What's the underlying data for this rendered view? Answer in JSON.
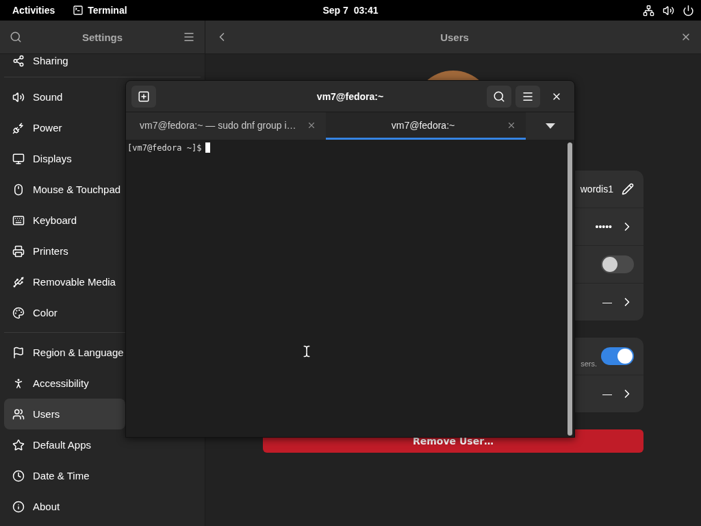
{
  "top_bar": {
    "activities": "Activities",
    "app": "Terminal",
    "date": "Sep 7",
    "time": "03:41"
  },
  "settings": {
    "sidebar_title": "Settings",
    "page_title": "Users",
    "sidebar_groups": [
      [
        {
          "label": "Sharing",
          "selected": false
        }
      ],
      [
        {
          "label": "Sound",
          "selected": false
        },
        {
          "label": "Power",
          "selected": false
        },
        {
          "label": "Displays",
          "selected": false
        },
        {
          "label": "Mouse & Touchpad",
          "selected": false
        },
        {
          "label": "Keyboard",
          "selected": false
        },
        {
          "label": "Printers",
          "selected": false
        },
        {
          "label": "Removable Media",
          "selected": false
        },
        {
          "label": "Color",
          "selected": false
        }
      ],
      [
        {
          "label": "Region & Language",
          "selected": false
        },
        {
          "label": "Accessibility",
          "selected": false
        },
        {
          "label": "Users",
          "selected": true
        },
        {
          "label": "Default Apps",
          "selected": false
        },
        {
          "label": "Date & Time",
          "selected": false
        },
        {
          "label": "About",
          "selected": false
        }
      ]
    ],
    "cards": [
      [
        {
          "kind": "edit",
          "value": "wordis1"
        },
        {
          "kind": "link",
          "value": "•••••"
        },
        {
          "kind": "switch",
          "on": false
        },
        {
          "kind": "link",
          "value": "—"
        }
      ],
      [
        {
          "kind": "switch",
          "on": true,
          "subtitle": "sers."
        },
        {
          "kind": "link",
          "value": "—"
        }
      ]
    ],
    "remove_button": "Remove User…"
  },
  "terminal": {
    "title": "vm7@fedora:~",
    "tabs": [
      {
        "label": "vm7@fedora:~ — sudo dnf group i…",
        "selected": false
      },
      {
        "label": "vm7@fedora:~",
        "selected": true
      }
    ],
    "prompt": "[vm7@fedora ~]$"
  }
}
